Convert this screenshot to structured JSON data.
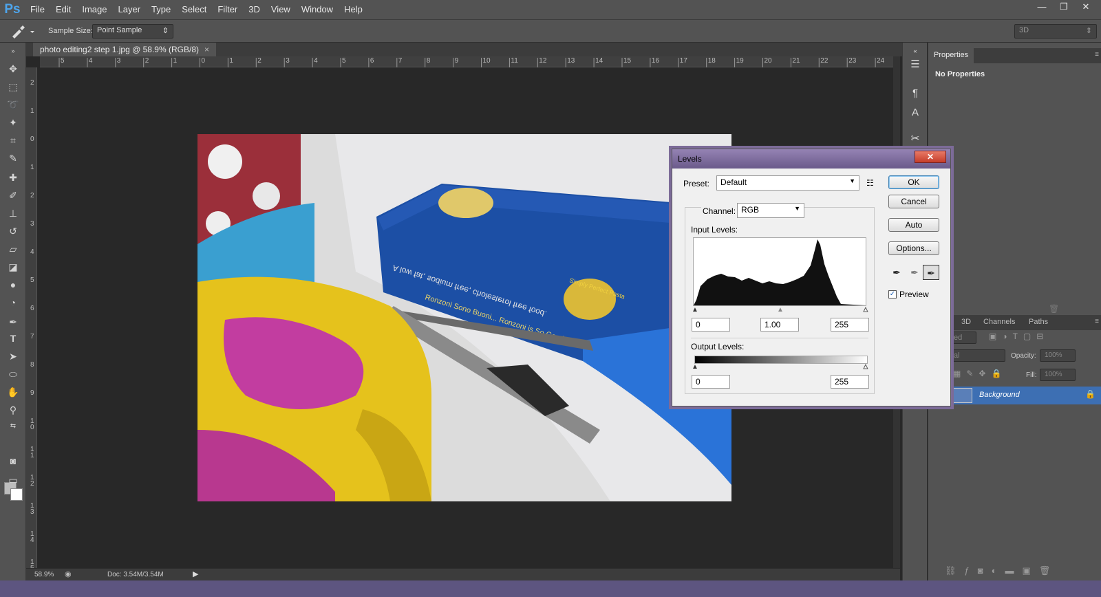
{
  "app": {
    "logo": "Ps",
    "menu": [
      "File",
      "Edit",
      "Image",
      "Layer",
      "Type",
      "Select",
      "Filter",
      "3D",
      "View",
      "Window",
      "Help"
    ],
    "window_controls": [
      "—",
      "❐",
      "✕"
    ]
  },
  "options_bar": {
    "sample_size_label": "Sample Size:",
    "sample_size_value": "Point Sample",
    "workspace_value": "3D"
  },
  "document": {
    "tab_title": "photo editing2 step 1.jpg @ 58.9% (RGB/8)",
    "close_glyph": "×",
    "ruler_h": [
      "5",
      "4",
      "3",
      "2",
      "1",
      "0",
      "1",
      "2",
      "3",
      "4",
      "5",
      "6",
      "7",
      "8",
      "9",
      "10",
      "11",
      "12",
      "13",
      "14",
      "15",
      "16",
      "17",
      "18",
      "19",
      "20",
      "21",
      "22",
      "23",
      "24"
    ],
    "ruler_v": [
      "2",
      "1",
      "0",
      "1",
      "2",
      "3",
      "4",
      "5",
      "6",
      "7",
      "8",
      "9",
      "10",
      "11",
      "12",
      "13",
      "14",
      "15"
    ],
    "zoom": "58.9%",
    "doc_info": "Doc: 3.54M/3.54M",
    "photo_text": {
      "pasta_slogan": "A low fat, sodium free, cholesterol free food.",
      "pasta_slogan2": "Ronzoni Sono Buoni... Ronzoni is So Good!",
      "pasta_brand": "Simply Perfect Pasta"
    }
  },
  "panels": {
    "properties_tab": "Properties",
    "no_properties": "No Properties",
    "layer_tabs": [
      "3D",
      "Channels",
      "Paths"
    ],
    "opacity_label": "Opacity:",
    "opacity_value": "100%",
    "fill_label": "Fill:",
    "fill_value": "100%",
    "blend_fragment": "ed",
    "kind_fragment": "al",
    "layer_name": "Background"
  },
  "levels": {
    "title": "Levels",
    "close": "✕",
    "preset_label": "Preset:",
    "preset_value": "Default",
    "channel_label": "Channel:",
    "channel_value": "RGB",
    "input_label": "Input Levels:",
    "input_black": "0",
    "input_gamma": "1.00",
    "input_white": "255",
    "output_label": "Output Levels:",
    "output_black": "0",
    "output_white": "255",
    "buttons": {
      "ok": "OK",
      "cancel": "Cancel",
      "auto": "Auto",
      "options": "Options..."
    },
    "preview_label": "Preview",
    "preview_checked": true
  }
}
